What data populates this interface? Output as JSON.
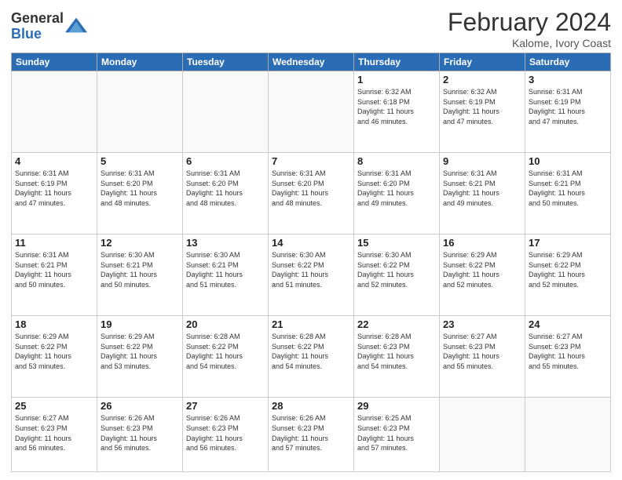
{
  "header": {
    "logo_general": "General",
    "logo_blue": "Blue",
    "month_title": "February 2024",
    "subtitle": "Kalome, Ivory Coast"
  },
  "weekdays": [
    "Sunday",
    "Monday",
    "Tuesday",
    "Wednesday",
    "Thursday",
    "Friday",
    "Saturday"
  ],
  "weeks": [
    [
      {
        "day": "",
        "info": ""
      },
      {
        "day": "",
        "info": ""
      },
      {
        "day": "",
        "info": ""
      },
      {
        "day": "",
        "info": ""
      },
      {
        "day": "1",
        "info": "Sunrise: 6:32 AM\nSunset: 6:18 PM\nDaylight: 11 hours\nand 46 minutes."
      },
      {
        "day": "2",
        "info": "Sunrise: 6:32 AM\nSunset: 6:19 PM\nDaylight: 11 hours\nand 47 minutes."
      },
      {
        "day": "3",
        "info": "Sunrise: 6:31 AM\nSunset: 6:19 PM\nDaylight: 11 hours\nand 47 minutes."
      }
    ],
    [
      {
        "day": "4",
        "info": "Sunrise: 6:31 AM\nSunset: 6:19 PM\nDaylight: 11 hours\nand 47 minutes."
      },
      {
        "day": "5",
        "info": "Sunrise: 6:31 AM\nSunset: 6:20 PM\nDaylight: 11 hours\nand 48 minutes."
      },
      {
        "day": "6",
        "info": "Sunrise: 6:31 AM\nSunset: 6:20 PM\nDaylight: 11 hours\nand 48 minutes."
      },
      {
        "day": "7",
        "info": "Sunrise: 6:31 AM\nSunset: 6:20 PM\nDaylight: 11 hours\nand 48 minutes."
      },
      {
        "day": "8",
        "info": "Sunrise: 6:31 AM\nSunset: 6:20 PM\nDaylight: 11 hours\nand 49 minutes."
      },
      {
        "day": "9",
        "info": "Sunrise: 6:31 AM\nSunset: 6:21 PM\nDaylight: 11 hours\nand 49 minutes."
      },
      {
        "day": "10",
        "info": "Sunrise: 6:31 AM\nSunset: 6:21 PM\nDaylight: 11 hours\nand 50 minutes."
      }
    ],
    [
      {
        "day": "11",
        "info": "Sunrise: 6:31 AM\nSunset: 6:21 PM\nDaylight: 11 hours\nand 50 minutes."
      },
      {
        "day": "12",
        "info": "Sunrise: 6:30 AM\nSunset: 6:21 PM\nDaylight: 11 hours\nand 50 minutes."
      },
      {
        "day": "13",
        "info": "Sunrise: 6:30 AM\nSunset: 6:21 PM\nDaylight: 11 hours\nand 51 minutes."
      },
      {
        "day": "14",
        "info": "Sunrise: 6:30 AM\nSunset: 6:22 PM\nDaylight: 11 hours\nand 51 minutes."
      },
      {
        "day": "15",
        "info": "Sunrise: 6:30 AM\nSunset: 6:22 PM\nDaylight: 11 hours\nand 52 minutes."
      },
      {
        "day": "16",
        "info": "Sunrise: 6:29 AM\nSunset: 6:22 PM\nDaylight: 11 hours\nand 52 minutes."
      },
      {
        "day": "17",
        "info": "Sunrise: 6:29 AM\nSunset: 6:22 PM\nDaylight: 11 hours\nand 52 minutes."
      }
    ],
    [
      {
        "day": "18",
        "info": "Sunrise: 6:29 AM\nSunset: 6:22 PM\nDaylight: 11 hours\nand 53 minutes."
      },
      {
        "day": "19",
        "info": "Sunrise: 6:29 AM\nSunset: 6:22 PM\nDaylight: 11 hours\nand 53 minutes."
      },
      {
        "day": "20",
        "info": "Sunrise: 6:28 AM\nSunset: 6:22 PM\nDaylight: 11 hours\nand 54 minutes."
      },
      {
        "day": "21",
        "info": "Sunrise: 6:28 AM\nSunset: 6:22 PM\nDaylight: 11 hours\nand 54 minutes."
      },
      {
        "day": "22",
        "info": "Sunrise: 6:28 AM\nSunset: 6:23 PM\nDaylight: 11 hours\nand 54 minutes."
      },
      {
        "day": "23",
        "info": "Sunrise: 6:27 AM\nSunset: 6:23 PM\nDaylight: 11 hours\nand 55 minutes."
      },
      {
        "day": "24",
        "info": "Sunrise: 6:27 AM\nSunset: 6:23 PM\nDaylight: 11 hours\nand 55 minutes."
      }
    ],
    [
      {
        "day": "25",
        "info": "Sunrise: 6:27 AM\nSunset: 6:23 PM\nDaylight: 11 hours\nand 56 minutes."
      },
      {
        "day": "26",
        "info": "Sunrise: 6:26 AM\nSunset: 6:23 PM\nDaylight: 11 hours\nand 56 minutes."
      },
      {
        "day": "27",
        "info": "Sunrise: 6:26 AM\nSunset: 6:23 PM\nDaylight: 11 hours\nand 56 minutes."
      },
      {
        "day": "28",
        "info": "Sunrise: 6:26 AM\nSunset: 6:23 PM\nDaylight: 11 hours\nand 57 minutes."
      },
      {
        "day": "29",
        "info": "Sunrise: 6:25 AM\nSunset: 6:23 PM\nDaylight: 11 hours\nand 57 minutes."
      },
      {
        "day": "",
        "info": ""
      },
      {
        "day": "",
        "info": ""
      }
    ]
  ]
}
